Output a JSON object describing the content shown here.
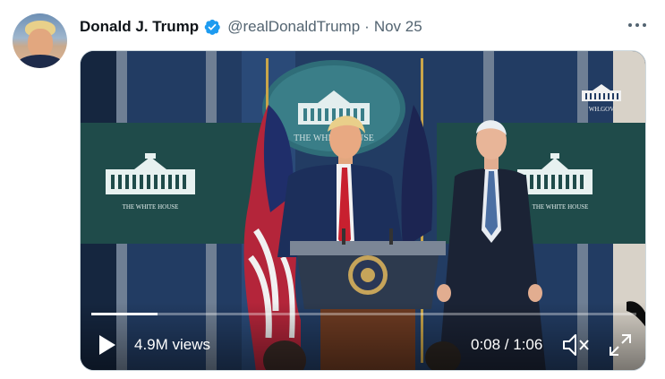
{
  "tweet": {
    "display_name": "Donald J. Trump",
    "handle": "@realDonaldTrump",
    "separator": "·",
    "date": "Nov 25",
    "verified": true
  },
  "video": {
    "views": "4.9M views",
    "time": "0:08 / 1:06",
    "progress": 0.121,
    "seal_text": "THE WHITE HOUSE",
    "panel_left_text": "THE WHITE HOUSE",
    "panel_right_text": "THE WHITE HOUSE",
    "watermark_text": "WH.GOV"
  },
  "colors": {
    "accent_verified": "#1d9bf0",
    "text_secondary": "#536471",
    "panel_teal": "#1f4b4a",
    "backdrop_blue": "#233f6b"
  },
  "icons": {
    "verified": "verified-badge-icon",
    "more": "more-options-icon",
    "play": "play-icon",
    "mute": "muted-speaker-icon",
    "fullscreen": "fullscreen-icon"
  }
}
